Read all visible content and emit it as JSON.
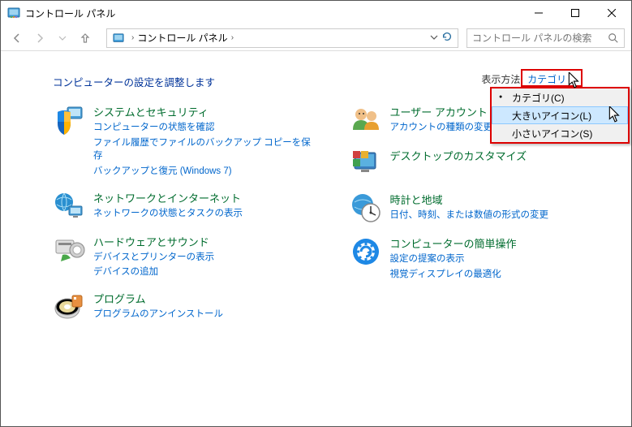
{
  "window": {
    "title": "コントロール パネル"
  },
  "nav": {
    "breadcrumb": "コントロール パネル",
    "search_placeholder": "コントロール パネルの検索"
  },
  "page": {
    "heading": "コンピューターの設定を調整します",
    "view_by_label": "表示方法:",
    "view_by_value": "カテゴリ"
  },
  "dropdown": {
    "items": [
      {
        "label": "カテゴリ(C)",
        "selected": true,
        "hover": false
      },
      {
        "label": "大きいアイコン(L)",
        "selected": false,
        "hover": true
      },
      {
        "label": "小さいアイコン(S)",
        "selected": false,
        "hover": false
      }
    ]
  },
  "categories_left": [
    {
      "title": "システムとセキュリティ",
      "links": [
        "コンピューターの状態を確認",
        "ファイル履歴でファイルのバックアップ コピーを保存",
        "バックアップと復元 (Windows 7)"
      ],
      "icon": "shield"
    },
    {
      "title": "ネットワークとインターネット",
      "links": [
        "ネットワークの状態とタスクの表示"
      ],
      "icon": "network"
    },
    {
      "title": "ハードウェアとサウンド",
      "links": [
        "デバイスとプリンターの表示",
        "デバイスの追加"
      ],
      "icon": "hardware"
    },
    {
      "title": "プログラム",
      "links": [
        "プログラムのアンインストール"
      ],
      "icon": "programs"
    }
  ],
  "categories_right": [
    {
      "title": "ユーザー アカウント",
      "links": [
        "アカウントの種類の変更"
      ],
      "icon": "users"
    },
    {
      "title": "デスクトップのカスタマイズ",
      "links": [],
      "icon": "appearance"
    },
    {
      "title": "時計と地域",
      "links": [
        "日付、時刻、または数値の形式の変更"
      ],
      "icon": "clock"
    },
    {
      "title": "コンピューターの簡単操作",
      "links": [
        "設定の提案の表示",
        "視覚ディスプレイの最適化"
      ],
      "icon": "ease"
    }
  ]
}
